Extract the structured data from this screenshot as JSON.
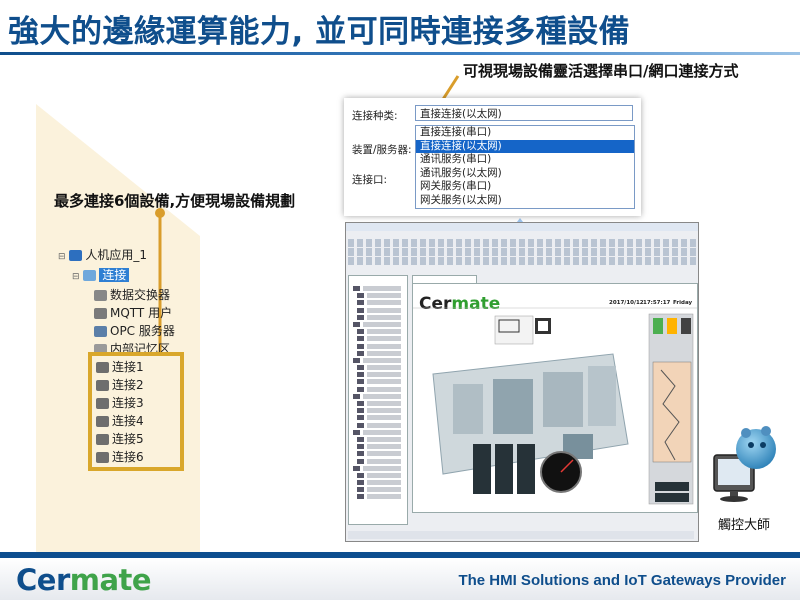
{
  "slide": {
    "title": "強大的邊緣運算能力, 並可同時連接多種設備",
    "callout_top": "可視現場設備靈活選擇串口/網口連接方式",
    "callout_left": "最多連接6個設備,方便現場設備規劃"
  },
  "dropdown": {
    "label_conn_type": "连接种类:",
    "label_device": "装置/服务器:",
    "label_port": "连接口:",
    "selected": "直接连接(以太网)",
    "options": [
      {
        "label": "直接连接(串口)",
        "selected": false
      },
      {
        "label": "直接连接(以太网)",
        "selected": true
      },
      {
        "label": "通讯服务(串口)",
        "selected": false
      },
      {
        "label": "通讯服务(以太网)",
        "selected": false
      },
      {
        "label": "网关服务(串口)",
        "selected": false
      },
      {
        "label": "网关服务(以太网)",
        "selected": false
      }
    ]
  },
  "tree": {
    "root": "人机应用_1",
    "conn_node": "连接",
    "children": [
      "数据交换器",
      "MQTT 用户",
      "OPC 服务器",
      "内部记忆区"
    ],
    "connections": [
      "连接1",
      "连接2",
      "连接3",
      "连接4",
      "连接5",
      "连接6"
    ]
  },
  "software": {
    "hmi_logo_main": "Cer",
    "hmi_logo_accent": "mate",
    "date": "2017/10/12",
    "time": "17:57:17",
    "day": "Friday"
  },
  "robot": {
    "label": "觸控大師"
  },
  "footer": {
    "logo_main": "Cer",
    "logo_accent": "mate",
    "slogan": "The HMI Solutions and IoT Gateways Provider"
  },
  "colors": {
    "title_blue": "#0f4e8c",
    "highlight_gold": "#d9a72b",
    "logo_green": "#3fa34a",
    "selected_blue": "#1565c8"
  }
}
